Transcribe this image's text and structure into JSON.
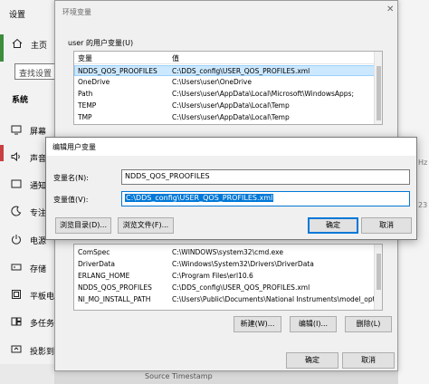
{
  "settings": {
    "title": "设置",
    "home_label": "主页",
    "search_placeholder": "查找设置",
    "section_title": "系统",
    "nav_items": [
      {
        "label": "屏幕",
        "icon": "monitor-icon"
      },
      {
        "label": "声音",
        "icon": "speaker-icon"
      },
      {
        "label": "通知",
        "icon": "notification-icon"
      },
      {
        "label": "专注",
        "icon": "moon-icon"
      },
      {
        "label": "电源",
        "icon": "power-icon"
      },
      {
        "label": "存储",
        "icon": "storage-icon"
      },
      {
        "label": "平板电",
        "icon": "tablet-icon"
      },
      {
        "label": "多任务处",
        "icon": "multitask-icon"
      },
      {
        "label": "投影到此",
        "icon": "projection-icon"
      }
    ]
  },
  "background": {
    "right_text1": "Hz",
    "right_text2": "23",
    "bottom_text": "Source Timestamp"
  },
  "env_window": {
    "title": "环境变量",
    "close_glyph": "✕",
    "user_group_title": "user 的用户变量(U)",
    "user_columns": [
      "变量",
      "值"
    ],
    "user_vars": [
      {
        "name": "NDDS_QOS_PROOFILES",
        "value": "C:\\DDS_config\\USER_QOS_PROFILES.xml",
        "selected": true
      },
      {
        "name": "OneDrive",
        "value": "C:\\Users\\user\\OneDrive"
      },
      {
        "name": "Path",
        "value": "C:\\Users\\user\\AppData\\Local\\Microsoft\\WindowsApps;"
      },
      {
        "name": "TEMP",
        "value": "C:\\Users\\user\\AppData\\Local\\Temp"
      },
      {
        "name": "TMP",
        "value": "C:\\Users\\user\\AppData\\Local\\Temp"
      }
    ],
    "sys_vars": [
      {
        "name": "ComSpec",
        "value": "C:\\WINDOWS\\system32\\cmd.exe"
      },
      {
        "name": "DriverData",
        "value": "C:\\Windows\\System32\\Drivers\\DriverData"
      },
      {
        "name": "ERLANG_HOME",
        "value": "C:\\Program Files\\erl10.6"
      },
      {
        "name": "NDDS_QOS_PROFILES",
        "value": "C:\\DDS_config\\USER_QOS_PROFILES.xml"
      },
      {
        "name": "NI_MO_INSTALL_PATH",
        "value": "C:\\Users\\Public\\Documents\\National Instruments\\model_opti..."
      }
    ],
    "sys_buttons": {
      "new": "新建(W)...",
      "edit": "编辑(I)...",
      "delete": "删除(L)"
    },
    "ok": "确定",
    "cancel": "取消"
  },
  "edit_dialog": {
    "title": "编辑用户变量",
    "name_label": "变量名(N):",
    "value_label": "变量值(V):",
    "name_value": "NDDS_QOS_PROOFILES",
    "value_value": "C:\\DDS_config\\USER_QOS_PROFILES.xml",
    "browse_dir": "浏览目录(D)...",
    "browse_file": "浏览文件(F)...",
    "ok": "确定",
    "cancel": "取消"
  },
  "colors": {
    "accent": "#0078d7",
    "selection": "#cce8ff"
  }
}
